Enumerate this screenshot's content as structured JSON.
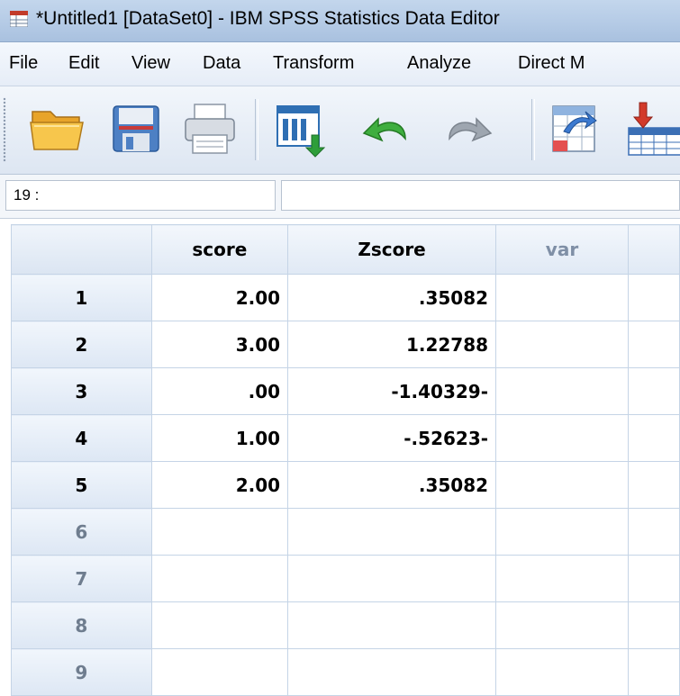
{
  "window": {
    "title": "*Untitled1 [DataSet0] - IBM SPSS Statistics Data Editor"
  },
  "menu": {
    "items": [
      "File",
      "Edit",
      "View",
      "Data",
      "Transform",
      "Analyze",
      "Direct M"
    ]
  },
  "toolbar": {
    "buttons": [
      {
        "icon": "open-folder-icon"
      },
      {
        "icon": "save-icon"
      },
      {
        "icon": "print-icon"
      },
      {
        "icon": "recall-dialog-icon"
      },
      {
        "icon": "undo-icon"
      },
      {
        "icon": "redo-icon"
      },
      {
        "icon": "goto-case-icon"
      },
      {
        "icon": "insert-cases-icon"
      }
    ]
  },
  "cell_editor": {
    "reference": "19 :",
    "value": ""
  },
  "grid": {
    "columns": [
      "score",
      "Zscore",
      "var"
    ],
    "rows": [
      {
        "num": "1",
        "score": "2.00",
        "zscore": ".35082"
      },
      {
        "num": "2",
        "score": "3.00",
        "zscore": "1.22788"
      },
      {
        "num": "3",
        "score": ".00",
        "zscore": "-1.40329-"
      },
      {
        "num": "4",
        "score": "1.00",
        "zscore": "-.52623-"
      },
      {
        "num": "5",
        "score": "2.00",
        "zscore": ".35082"
      },
      {
        "num": "6",
        "score": "",
        "zscore": ""
      },
      {
        "num": "7",
        "score": "",
        "zscore": ""
      },
      {
        "num": "8",
        "score": "",
        "zscore": ""
      },
      {
        "num": "9",
        "score": "",
        "zscore": ""
      }
    ]
  }
}
